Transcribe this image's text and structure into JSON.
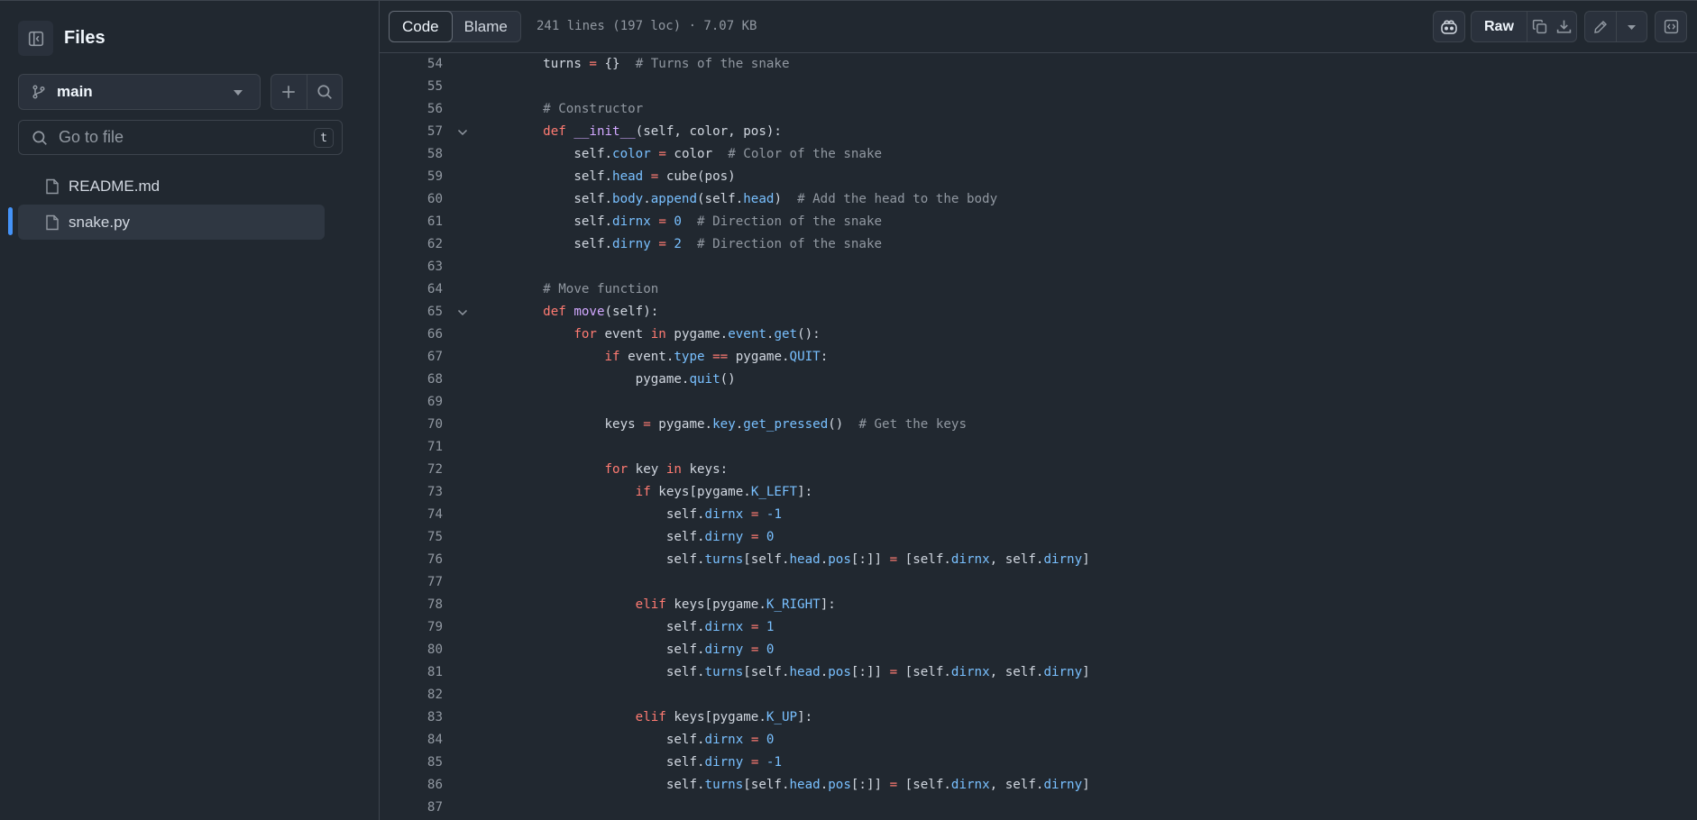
{
  "sidebar": {
    "title": "Files",
    "branch": "main",
    "goto_placeholder": "Go to file",
    "goto_shortcut": "t",
    "files": [
      {
        "name": "README.md",
        "active": false
      },
      {
        "name": "snake.py",
        "active": true
      }
    ]
  },
  "toolbar": {
    "tabs": [
      {
        "label": "Code",
        "active": true
      },
      {
        "label": "Blame",
        "active": false
      }
    ],
    "meta": "241 lines (197 loc) · 7.07 KB",
    "raw_label": "Raw"
  },
  "icons": [
    "sidebar-collapse-icon",
    "git-branch-icon",
    "caret-down-icon",
    "plus-icon",
    "search-icon",
    "file-icon",
    "copilot-icon",
    "copy-icon",
    "download-icon",
    "pencil-icon",
    "symbols-icon",
    "chevron-down-icon"
  ],
  "colors": {
    "keyword": "#ff7b72",
    "function": "#d2a8ff",
    "property": "#79c0ff",
    "comment": "#9198a1",
    "accent": "#4493f8"
  },
  "code": {
    "lines": [
      {
        "n": "54",
        "fold": false,
        "text": "    turns = {}  # Turns of the snake"
      },
      {
        "n": "55",
        "fold": false,
        "text": ""
      },
      {
        "n": "56",
        "fold": false,
        "text": "    # Constructor"
      },
      {
        "n": "57",
        "fold": true,
        "text": "    def __init__(self, color, pos):"
      },
      {
        "n": "58",
        "fold": false,
        "text": "        self.color = color  # Color of the snake"
      },
      {
        "n": "59",
        "fold": false,
        "text": "        self.head = cube(pos)"
      },
      {
        "n": "60",
        "fold": false,
        "text": "        self.body.append(self.head)  # Add the head to the body"
      },
      {
        "n": "61",
        "fold": false,
        "text": "        self.dirnx = 0  # Direction of the snake"
      },
      {
        "n": "62",
        "fold": false,
        "text": "        self.dirny = 2  # Direction of the snake"
      },
      {
        "n": "63",
        "fold": false,
        "text": ""
      },
      {
        "n": "64",
        "fold": false,
        "text": "    # Move function"
      },
      {
        "n": "65",
        "fold": true,
        "text": "    def move(self):"
      },
      {
        "n": "66",
        "fold": false,
        "text": "        for event in pygame.event.get():"
      },
      {
        "n": "67",
        "fold": false,
        "text": "            if event.type == pygame.QUIT:"
      },
      {
        "n": "68",
        "fold": false,
        "text": "                pygame.quit()"
      },
      {
        "n": "69",
        "fold": false,
        "text": ""
      },
      {
        "n": "70",
        "fold": false,
        "text": "            keys = pygame.key.get_pressed()  # Get the keys"
      },
      {
        "n": "71",
        "fold": false,
        "text": ""
      },
      {
        "n": "72",
        "fold": false,
        "text": "            for key in keys:"
      },
      {
        "n": "73",
        "fold": false,
        "text": "                if keys[pygame.K_LEFT]:"
      },
      {
        "n": "74",
        "fold": false,
        "text": "                    self.dirnx = -1"
      },
      {
        "n": "75",
        "fold": false,
        "text": "                    self.dirny = 0"
      },
      {
        "n": "76",
        "fold": false,
        "text": "                    self.turns[self.head.pos[:]] = [self.dirnx, self.dirny]"
      },
      {
        "n": "77",
        "fold": false,
        "text": ""
      },
      {
        "n": "78",
        "fold": false,
        "text": "                elif keys[pygame.K_RIGHT]:"
      },
      {
        "n": "79",
        "fold": false,
        "text": "                    self.dirnx = 1"
      },
      {
        "n": "80",
        "fold": false,
        "text": "                    self.dirny = 0"
      },
      {
        "n": "81",
        "fold": false,
        "text": "                    self.turns[self.head.pos[:]] = [self.dirnx, self.dirny]"
      },
      {
        "n": "82",
        "fold": false,
        "text": ""
      },
      {
        "n": "83",
        "fold": false,
        "text": "                elif keys[pygame.K_UP]:"
      },
      {
        "n": "84",
        "fold": false,
        "text": "                    self.dirnx = 0"
      },
      {
        "n": "85",
        "fold": false,
        "text": "                    self.dirny = -1"
      },
      {
        "n": "86",
        "fold": false,
        "text": "                    self.turns[self.head.pos[:]] = [self.dirnx, self.dirny]"
      },
      {
        "n": "87",
        "fold": false,
        "text": ""
      }
    ]
  }
}
